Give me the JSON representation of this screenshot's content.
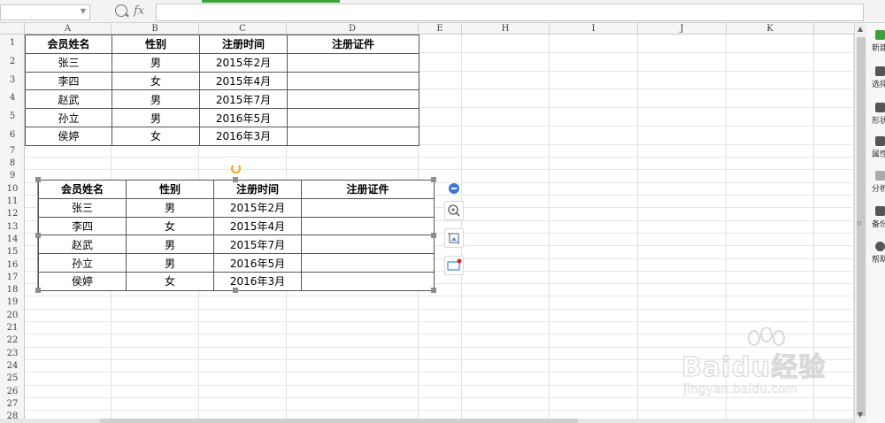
{
  "formula_bar": {
    "name_box": "",
    "fx_label": "fx",
    "formula": ""
  },
  "columns": [
    "A",
    "B",
    "C",
    "D",
    "E",
    "H",
    "I",
    "J",
    "K"
  ],
  "rows": [
    "1",
    "2",
    "3",
    "4",
    "5",
    "6",
    "7",
    "8",
    "9",
    "10",
    "11",
    "12",
    "13",
    "14",
    "15",
    "16",
    "17",
    "18",
    "19",
    "20",
    "21",
    "22",
    "23",
    "24",
    "25",
    "26",
    "27",
    "28"
  ],
  "table1": {
    "headers": [
      "会员姓名",
      "性别",
      "注册时间",
      "注册证件"
    ],
    "rows": [
      [
        "张三",
        "男",
        "2015年2月",
        ""
      ],
      [
        "李四",
        "女",
        "2015年4月",
        ""
      ],
      [
        "赵武",
        "男",
        "2015年7月",
        ""
      ],
      [
        "孙立",
        "男",
        "2016年5月",
        ""
      ],
      [
        "侯婷",
        "女",
        "2016年3月",
        ""
      ]
    ]
  },
  "table2": {
    "headers": [
      "会员姓名",
      "性别",
      "注册时间",
      "注册证件"
    ],
    "rows": [
      [
        "张三",
        "男",
        "2015年2月",
        ""
      ],
      [
        "李四",
        "女",
        "2015年4月",
        ""
      ],
      [
        "赵武",
        "男",
        "2015年7月",
        ""
      ],
      [
        "孙立",
        "男",
        "2016年5月",
        ""
      ],
      [
        "侯婷",
        "女",
        "2016年3月",
        ""
      ]
    ]
  },
  "side_panel": [
    {
      "label": "新建",
      "icon": "new-icon",
      "color": "#3aa43a"
    },
    {
      "label": "选择",
      "icon": "select-icon",
      "color": "#555555"
    },
    {
      "label": "形状",
      "icon": "shape-icon",
      "color": "#555555"
    },
    {
      "label": "属性",
      "icon": "properties-icon",
      "color": "#555555"
    },
    {
      "label": "分析",
      "icon": "analysis-icon",
      "color": "#aaaaaa"
    },
    {
      "label": "备份",
      "icon": "backup-icon",
      "color": "#555555"
    },
    {
      "label": "帮助",
      "icon": "help-icon",
      "color": "#555555"
    }
  ],
  "watermark": {
    "brand": "Baidu经验",
    "url": "jingyan.baidu.com"
  }
}
